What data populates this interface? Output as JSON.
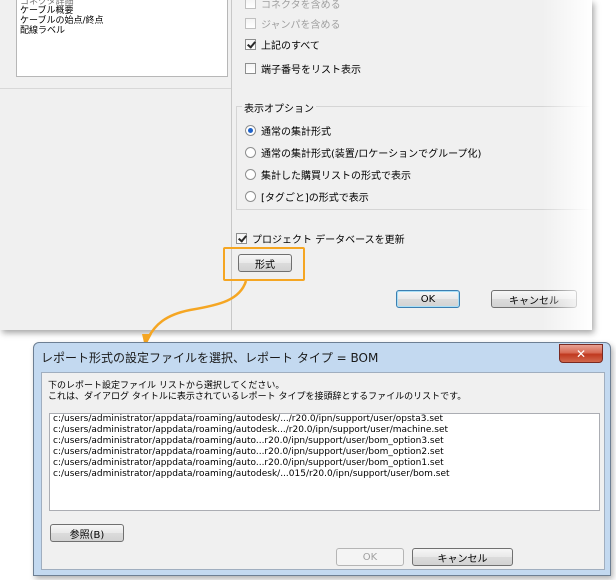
{
  "top_dialog": {
    "left_list_items": [
      "コネクタ詳細",
      "ケーブル概要",
      "ケーブルの始点/終点",
      "配線ラベル"
    ],
    "checkboxes": [
      {
        "label": "コネクタを含める",
        "checked": false,
        "disabled": true
      },
      {
        "label": "ジャンパを含める",
        "checked": false,
        "disabled": true
      },
      {
        "label": "上記のすべて",
        "checked": true,
        "disabled": false
      },
      {
        "label": "端子番号をリスト表示",
        "checked": false,
        "disabled": false
      }
    ],
    "display_options_title": "表示オプション",
    "radio_options": [
      {
        "label": "通常の集計形式",
        "selected": true
      },
      {
        "label": "通常の集計形式(装置/ロケーションでグループ化)",
        "selected": false
      },
      {
        "label": "集計した購買リストの形式で表示",
        "selected": false
      },
      {
        "label": "[タグごと]の形式で表示",
        "selected": false
      }
    ],
    "update_db_label": "プロジェクト データベースを更新",
    "update_db_checked": true,
    "format_button": "形式",
    "ok_button": "OK",
    "cancel_button": "キャンセル"
  },
  "dialog": {
    "title": "レポート形式の設定ファイルを選択、レポート タイプ = BOM",
    "close_glyph": "✕",
    "instruction_1": "下のレポート設定ファイル リストから選択してください。",
    "instruction_2": "これは、ダイアログ タイトルに表示されているレポート タイプを接頭辞とするファイルのリストです。",
    "files": [
      "c:/users/administrator/appdata/roaming/autodesk/.../r20.0/ipn/support/user/opsta3.set",
      "c:/users/administrator/appdata/roaming/autodesk.../r20.0/ipn/support/user/machine.set",
      "c:/users/administrator/appdata/roaming/auto...r20.0/ipn/support/user/bom_option3.set",
      "c:/users/administrator/appdata/roaming/auto...r20.0/ipn/support/user/bom_option2.set",
      "c:/users/administrator/appdata/roaming/auto...r20.0/ipn/support/user/bom_option1.set",
      "c:/users/administrator/appdata/roaming/autodesk/...015/r20.0/ipn/support/user/bom.set"
    ],
    "browse_button": "参照(B)",
    "ok_button": "OK",
    "cancel_button": "キャンセル"
  },
  "colors": {
    "highlight": "#f5a623",
    "title_bar": "#c3d9f0",
    "close_button": "#c0391f"
  }
}
